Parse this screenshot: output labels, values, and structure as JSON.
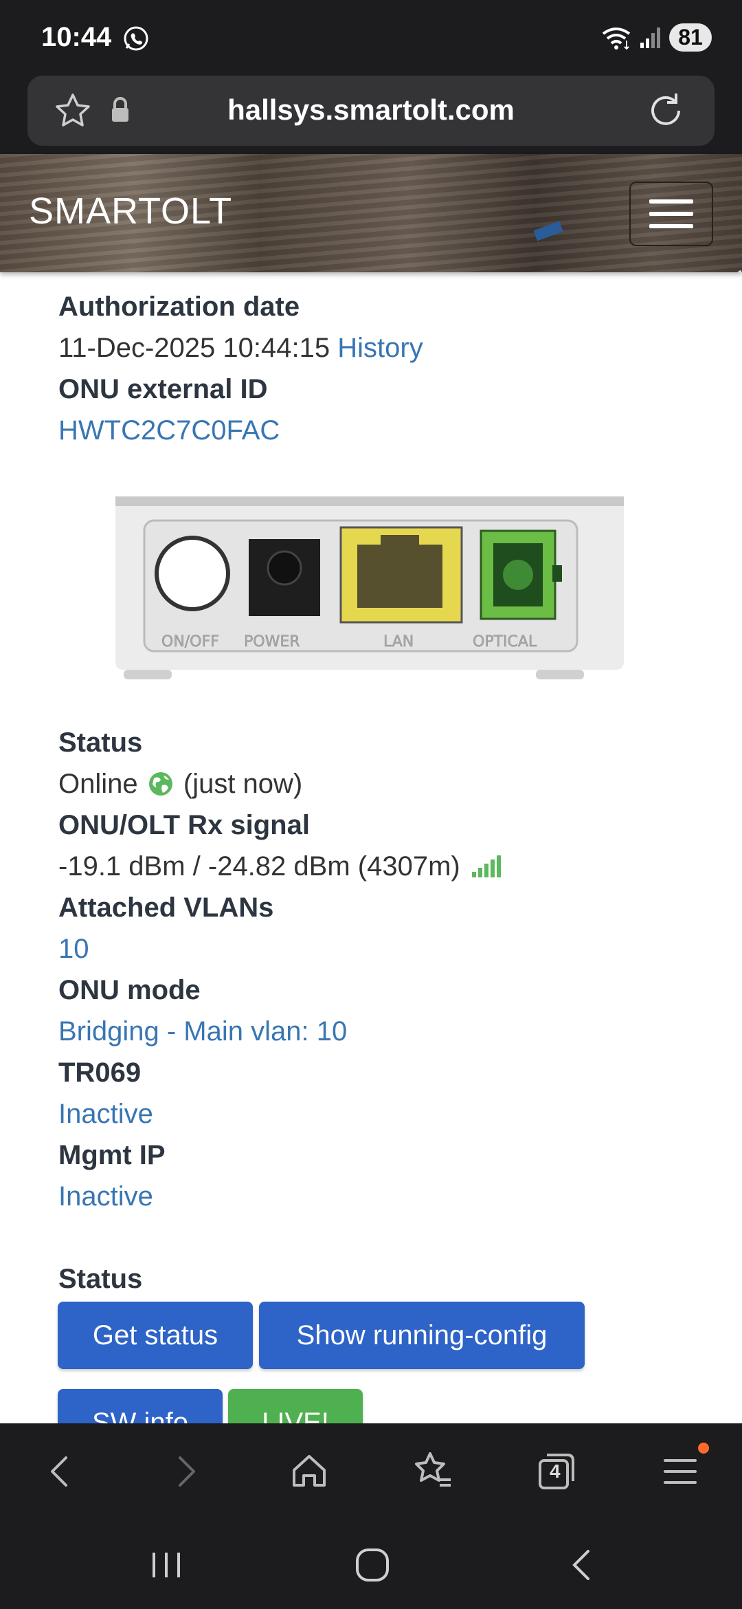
{
  "status_bar": {
    "time": "10:44",
    "battery": "81"
  },
  "browser": {
    "url": "hallsys.smartolt.com",
    "tab_count": "4"
  },
  "site": {
    "brand": "SMARTOLT"
  },
  "details": {
    "cutoff_value": "None",
    "authorization_date_label": "Authorization date",
    "authorization_date_value": "11-Dec-2025 10:44:15",
    "history_link": "History",
    "external_id_label": "ONU external ID",
    "external_id_value": "HWTC2C7C0FAC",
    "device_ports": [
      "ON/OFF",
      "POWER",
      "LAN",
      "OPTICAL"
    ],
    "status_label": "Status",
    "status_value": "Online",
    "status_time": "(just now)",
    "rx_signal_label": "ONU/OLT Rx signal",
    "rx_signal_value": "-19.1 dBm / -24.82 dBm (4307m)",
    "vlans_label": "Attached VLANs",
    "vlans_value": "10",
    "mode_label": "ONU mode",
    "mode_value": "Bridging - Main vlan: 10",
    "tr069_label": "TR069",
    "tr069_value": "Inactive",
    "mgmt_ip_label": "Mgmt IP",
    "mgmt_ip_value": "Inactive"
  },
  "actions": {
    "section_label": "Status",
    "get_status": "Get status",
    "show_running_config": "Show running-config",
    "sw_info": "SW info",
    "live": "LIVE!"
  },
  "colors": {
    "link": "#3876b4",
    "button_blue": "#2e63c8",
    "button_green": "#4fb04f",
    "signal": "#5cb85c"
  }
}
